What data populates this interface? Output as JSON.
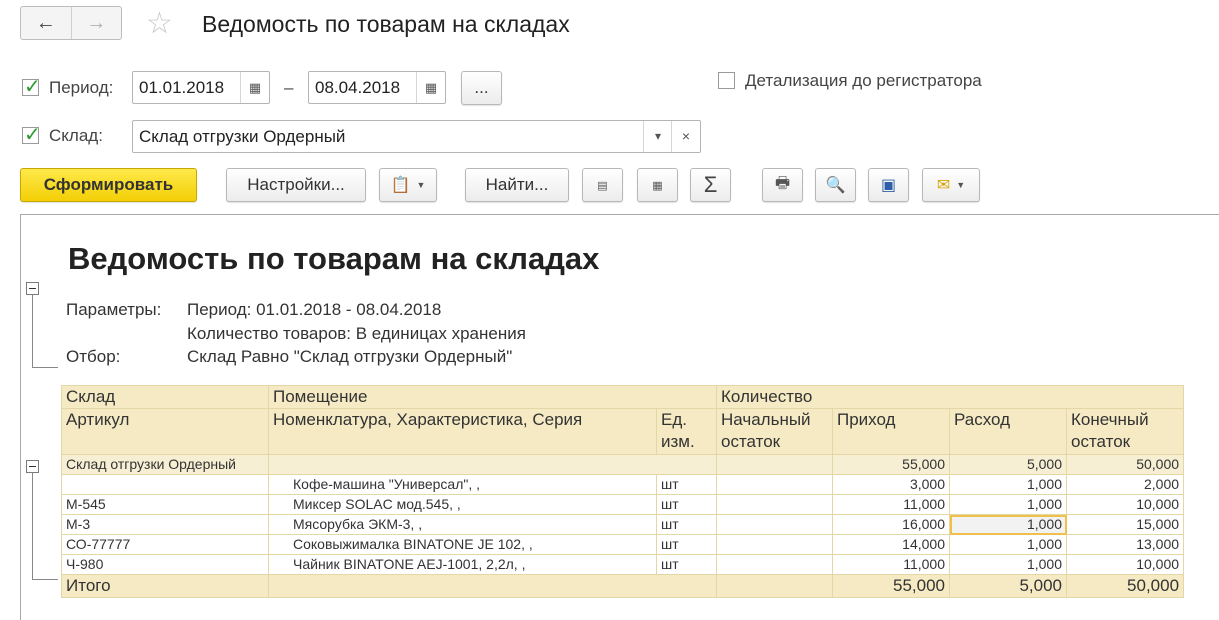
{
  "window": {
    "title": "Ведомость по товарам на складах",
    "back_icon": "←",
    "forward_icon": "→",
    "star_icon": "☆"
  },
  "filters": {
    "period_label": "Период:",
    "period_from": "01.01.2018",
    "dash": "–",
    "period_to": "08.04.2018",
    "period_more": "...",
    "detail_label": "Детализация до регистратора",
    "warehouse_label": "Склад:",
    "warehouse_value": "Склад отгрузки Ордерный",
    "dropdown_glyph": "▾",
    "clear_glyph": "×"
  },
  "toolbar": {
    "generate": "Сформировать",
    "settings": "Настройки...",
    "find": "Найти...",
    "sum_glyph": "Σ"
  },
  "report": {
    "title": "Ведомость по товарам на складах",
    "params_label": "Параметры:",
    "period_text": "Период: 01.01.2018 - 08.04.2018",
    "qty_text": "Количество товаров: В единицах хранения",
    "filter_label": "Отбор:",
    "filter_text": "Склад Равно \"Склад отгрузки Ордерный\""
  },
  "table": {
    "headers": {
      "warehouse": "Склад",
      "room": "Помещение",
      "quantity": "Количество",
      "article": "Артикул",
      "nomenclature": "Номенклатура, Характеристика, Серия",
      "unit": "Ед. изм.",
      "opening": "Начальный остаток",
      "incoming": "Приход",
      "outgoing": "Расход",
      "closing": "Конечный остаток"
    },
    "group": {
      "name": "Склад отгрузки Ордерный",
      "incoming": "55,000",
      "outgoing": "5,000",
      "closing": "50,000"
    },
    "rows": [
      {
        "article": "",
        "name": "Кофе-машина \"Универсал\", ,",
        "unit": "шт",
        "opening": "",
        "incoming": "3,000",
        "outgoing": "1,000",
        "closing": "2,000"
      },
      {
        "article": "М-545",
        "name": "Миксер SOLAC мод.545, ,",
        "unit": "шт",
        "opening": "",
        "incoming": "11,000",
        "outgoing": "1,000",
        "closing": "10,000"
      },
      {
        "article": "М-3",
        "name": "Мясорубка ЭКМ-3, ,",
        "unit": "шт",
        "opening": "",
        "incoming": "16,000",
        "outgoing": "1,000",
        "closing": "15,000"
      },
      {
        "article": "СО-77777",
        "name": "Соковыжималка  BINATONE JE 102, ,",
        "unit": "шт",
        "opening": "",
        "incoming": "14,000",
        "outgoing": "1,000",
        "closing": "13,000"
      },
      {
        "article": "Ч-980",
        "name": "Чайник BINATONE  AEJ-1001,  2,2л, ,",
        "unit": "шт",
        "opening": "",
        "incoming": "11,000",
        "outgoing": "1,000",
        "closing": "10,000"
      }
    ],
    "total": {
      "label": "Итого",
      "incoming": "55,000",
      "outgoing": "5,000",
      "closing": "50,000"
    }
  }
}
